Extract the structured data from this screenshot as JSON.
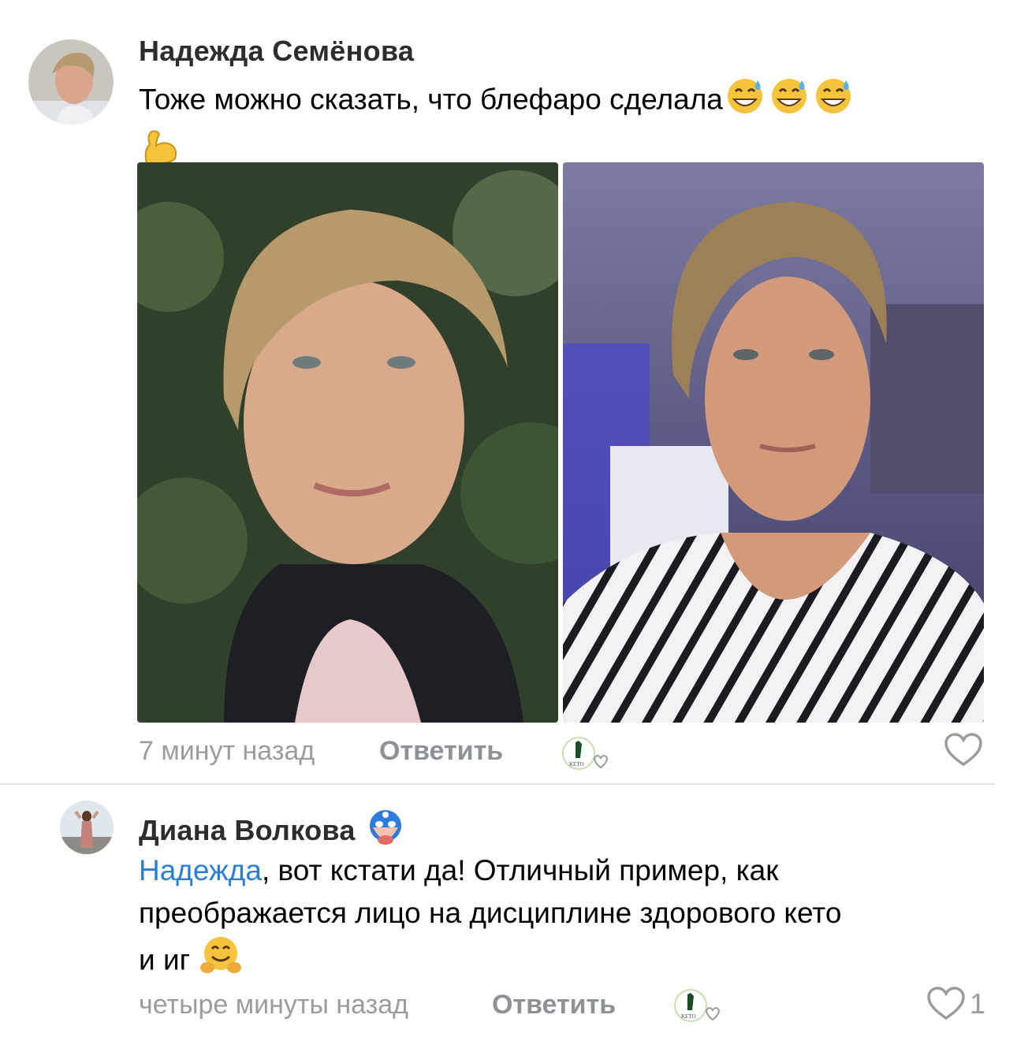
{
  "comments": [
    {
      "author": "Надежда Семёнова",
      "text": "Тоже можно сказать, что блефаро сделала",
      "emojis_text": [
        "grinning-sweat",
        "grinning-sweat",
        "grinning-sweat",
        "flexed-biceps"
      ],
      "photos": [
        "before-photo",
        "after-photo"
      ],
      "time": "7 минут назад",
      "reply_label": "Ответить",
      "badge_label": "KETO",
      "likes": ""
    },
    {
      "author": "Диана Волкова",
      "author_emoji": "masked-superhero",
      "mention": "Надежда",
      "text_line1": ", вот кстати да! Отличный пример, как",
      "text_line2": "преображается лицо на дисциплине здорового кето",
      "text_line3": "и иг",
      "text_emoji": "hugging-face",
      "time": "четыре минуты назад",
      "reply_label": "Ответить",
      "badge_label": "KETO",
      "likes": "1"
    }
  ],
  "colors": {
    "mention": "#2a7fd4",
    "meta": "#9a9ca0",
    "divider": "#e3e4e6"
  }
}
